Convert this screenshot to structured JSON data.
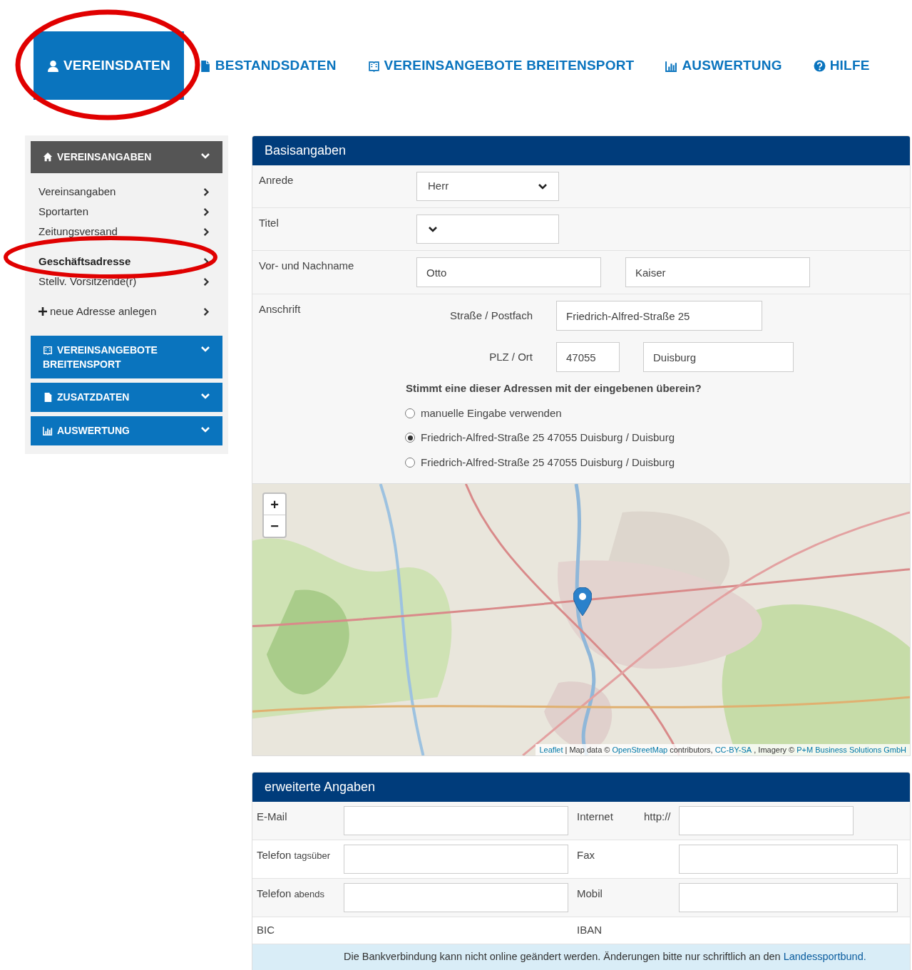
{
  "tabs": [
    {
      "label": "VEREINSDATEN",
      "selected": true
    },
    {
      "label": "BESTANDSDATEN",
      "selected": false
    },
    {
      "label": "VEREINSANGEBOTE BREITENSPORT",
      "selected": false
    },
    {
      "label": "AUSWERTUNG",
      "selected": false
    },
    {
      "label": "HILFE",
      "selected": false
    }
  ],
  "sidebar": {
    "sections": [
      {
        "title": "VEREINSANGABEN",
        "selected": true,
        "items": [
          {
            "label": "Vereinsangaben",
            "selected": false
          },
          {
            "label": "Sportarten",
            "selected": false
          },
          {
            "label": "Zeitungsversand",
            "selected": false
          },
          {
            "label": "Geschäftsadresse",
            "selected": true
          },
          {
            "label": "Stellv. Vorsitzende(r)",
            "selected": false
          },
          {
            "label": "neue Adresse anlegen",
            "selected": false,
            "kind": "add"
          }
        ]
      },
      {
        "title": "VEREINSANGEBOTE BREITENSPORT",
        "selected": false
      },
      {
        "title": "ZUSATZDATEN",
        "selected": false
      },
      {
        "title": "AUSWERTUNG",
        "selected": false
      }
    ]
  },
  "basis": {
    "title": "Basisangaben",
    "anrede": {
      "label": "Anrede",
      "value": "Herr"
    },
    "titel": {
      "label": "Titel"
    },
    "name": {
      "label": "Vor- und Nachname",
      "first": "Otto",
      "last": "Kaiser"
    },
    "anschrift": {
      "label": "Anschrift",
      "street_label": "Straße / Postfach",
      "street": "Friedrich-Alfred-Straße 25",
      "plz_label": "PLZ / Ort",
      "plz": "47055",
      "ort": "Duisburg"
    },
    "question": "Stimmt eine dieser Adressen mit der eingebenen überein?",
    "options": [
      {
        "label": "manuelle Eingabe verwenden",
        "selected": false
      },
      {
        "label": "Friedrich-Alfred-Straße 25 47055 Duisburg / Duisburg",
        "selected": true
      },
      {
        "label": "Friedrich-Alfred-Straße 25 47055 Duisburg / Duisburg",
        "selected": false
      }
    ],
    "map": {
      "zoom_in": "+",
      "zoom_out": "−",
      "attribution": [
        {
          "text": "Leaflet",
          "kind": "link"
        },
        {
          "text": "| Map data ©",
          "kind": "text"
        },
        {
          "text": "OpenStreetMap",
          "kind": "link"
        },
        {
          "text": "contributors,",
          "kind": "text"
        },
        {
          "text": "CC-BY-SA",
          "kind": "link"
        },
        {
          "text": ", Imagery ©",
          "kind": "text"
        },
        {
          "text": "P+M Business Solutions GmbH",
          "kind": "link"
        }
      ]
    }
  },
  "erweitert": {
    "title": "erweiterte Angaben",
    "rows": [
      {
        "left": {
          "label": "E-Mail"
        },
        "right": {
          "label": "Internet",
          "prefix": "http://"
        }
      },
      {
        "left": {
          "label": "Telefon",
          "small": "tagsüber"
        },
        "right": {
          "label": "Fax"
        }
      },
      {
        "left": {
          "label": "Telefon",
          "small": "abends"
        },
        "right": {
          "label": "Mobil"
        }
      }
    ],
    "bic": "BIC",
    "iban": "IBAN",
    "notice": "Die Bankverbindung kann nicht online geändert werden. Änderungen bitte nur schriftlich an den",
    "notice_link": "Landessportbund."
  }
}
